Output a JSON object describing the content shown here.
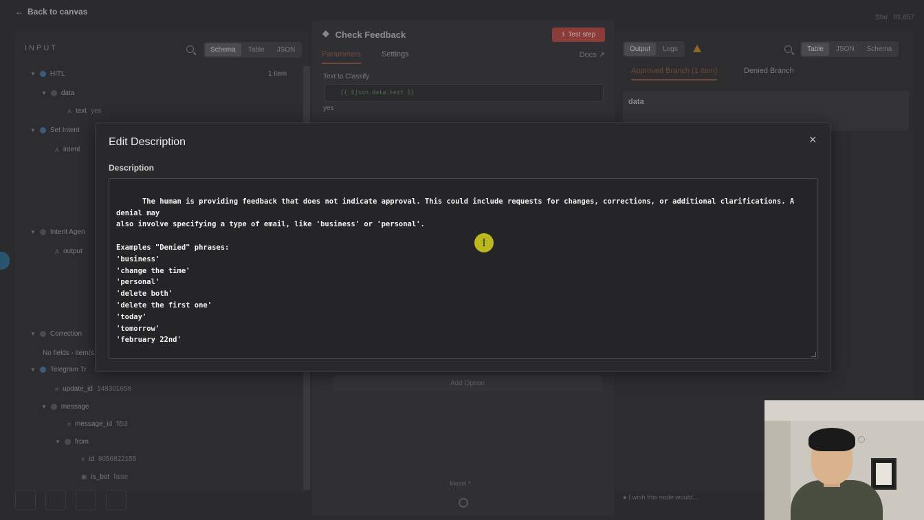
{
  "topbar": {
    "back_label": "Back to canvas",
    "star_label": "Star",
    "star_count": "81,657"
  },
  "input_panel": {
    "header": "INPUT",
    "view_tabs": [
      "Schema",
      "Table",
      "JSON"
    ],
    "item_count": "1 item",
    "tree": [
      {
        "label": "HITL",
        "type": "node"
      },
      {
        "label": "data",
        "type": "object"
      },
      {
        "label": "text",
        "value": "yes",
        "type": "string"
      },
      {
        "label": "Set Intent",
        "type": "node"
      },
      {
        "label": "intent",
        "type": "string"
      },
      {
        "label": "Intent Agen",
        "type": "node"
      },
      {
        "label": "output",
        "type": "string"
      },
      {
        "label": "Correction",
        "type": "node"
      },
      {
        "label": "No fields - item(s",
        "type": "note"
      },
      {
        "label": "Telegram Tr",
        "type": "node"
      },
      {
        "label": "update_id",
        "value": "148301656",
        "type": "number"
      },
      {
        "label": "message",
        "type": "object"
      },
      {
        "label": "message_id",
        "value": "553",
        "type": "number"
      },
      {
        "label": "from",
        "type": "object"
      },
      {
        "label": "id",
        "value": "8056822155",
        "type": "number"
      },
      {
        "label": "is_bot",
        "value": "false",
        "type": "bool"
      }
    ]
  },
  "node_panel": {
    "title": "Check Feedback",
    "test_label": "Test step",
    "tabs": [
      "Parameters",
      "Settings"
    ],
    "docs_label": "Docs",
    "text_to_classify_label": "Text to Classify",
    "expression": "{{ $json.data.text }}",
    "preview": "yes",
    "add_option_label": "Add Option",
    "model_label": "Model *"
  },
  "output_panel": {
    "tabs": [
      "Output",
      "Logs"
    ],
    "view_tabs": [
      "Table",
      "JSON",
      "Schema"
    ],
    "branch_tabs": [
      "Approved Branch (1 item)",
      "Denied Branch"
    ],
    "data_label": "data",
    "wish_label": "I wish this node would..."
  },
  "modal": {
    "title": "Edit Description",
    "close_glyph": "×",
    "field_label": "Description",
    "description": "The human is providing feedback that does not indicate approval. This could include requests for changes, corrections, or additional clarifications. A denial may\nalso involve specifying a type of email, like 'business' or 'personal'.\n\nExamples \"Denied\" phrases:\n'business'\n'change the time'\n'personal'\n'delete both'\n'delete the first one'\n'today'\n'tomorrow'\n'february 22nd'"
  },
  "icons": [
    "arrow-left-icon",
    "search-icon",
    "tag-icon",
    "flask-icon",
    "external-link-icon",
    "warning-icon",
    "close-icon",
    "gear-icon",
    "lightbulb-icon",
    "text-cursor-icon"
  ],
  "colors": {
    "accent": "#6e4a3c",
    "test_button": "#8a3d38",
    "cursor_highlight": "#d6d21e",
    "modal_bg": "#29292b"
  }
}
